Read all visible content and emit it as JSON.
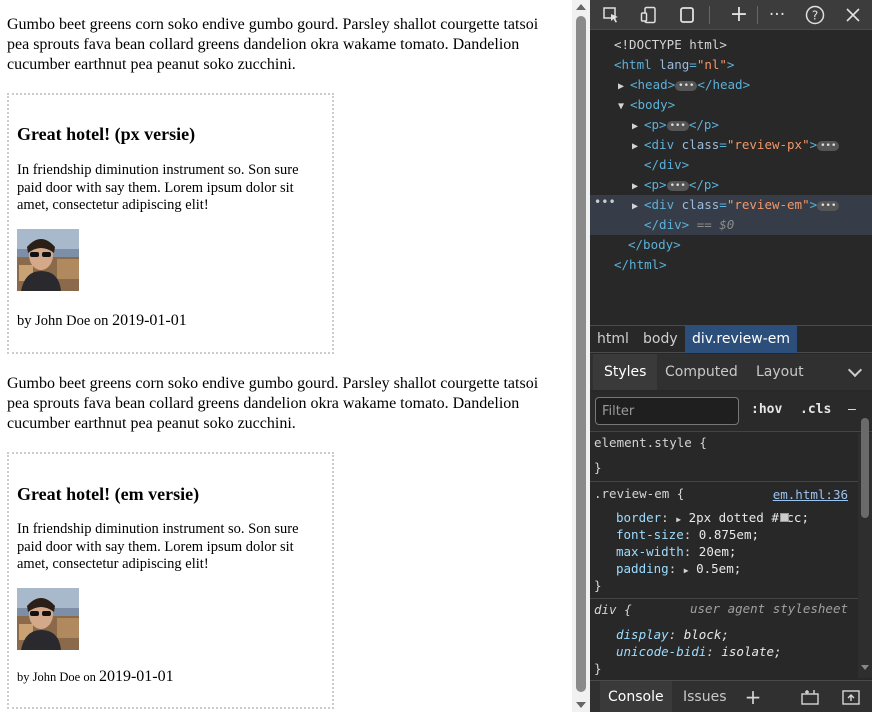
{
  "page": {
    "paragraph": "Gumbo beet greens corn soko endive gumbo gourd. Parsley shallot courgette tatsoi pea sprouts fava bean collard greens dandelion okra wakame tomato. Dandelion cucumber earthnut pea peanut soko zucchini.",
    "review_px": {
      "title": "Great hotel! (px versie)",
      "text": "In friendship diminution instrument so. Son sure paid door with say them. Lorem ipsum dolor sit amet, consectetur adipiscing elit!",
      "byline": "by John Doe on ",
      "date": "2019-01-01"
    },
    "review_em": {
      "title": "Great hotel! (em versie)",
      "text": "In friendship diminution instrument so. Son sure paid door with say them. Lorem ipsum dolor sit amet, consectetur adipiscing elit!",
      "byline": "by John Doe on ",
      "date": "2019-01-01"
    }
  },
  "devtools": {
    "toolbar_icons": [
      "inspect-icon",
      "device-icon",
      "panel-icon",
      "new-tab-icon",
      "more-icon",
      "help-icon",
      "close-icon"
    ],
    "dom": {
      "doctype": "<!DOCTYPE html>",
      "html_tag": "<html",
      "html_attr_name": "lang",
      "html_attr_value": "\"nl\"",
      "head": "<head>",
      "head_close": "</head>",
      "body": "<body>",
      "p_open": "<p>",
      "p_close": "</p>",
      "div_tag": "<div",
      "class_attr": "class",
      "div_px_class": "\"review-px\"",
      "div_em_class": "\"review-em\"",
      "div_close": "</div>",
      "dollar_zero": "== $0",
      "body_close": "</body>",
      "html_close": "</html>",
      "gutter": "•••"
    },
    "breadcrumbs": [
      "html",
      "body",
      "div.review-em"
    ],
    "tabs": [
      "Styles",
      "Computed",
      "Layout"
    ],
    "filter_placeholder": "Filter",
    "filter_buttons": [
      ":hov",
      ".cls"
    ],
    "styles": {
      "element_style": "element.style {",
      "close_brace": "}",
      "review_selector": ".review-em {",
      "review_source": "em.html:36",
      "props": [
        {
          "name": "border",
          "value": "2px dotted #ccc;"
        },
        {
          "name": "font-size",
          "value": "0.875em;"
        },
        {
          "name": "max-width",
          "value": "20em;"
        },
        {
          "name": "padding",
          "value": "0.5em;"
        }
      ],
      "ua_selector": "div {",
      "ua_source": "user agent stylesheet",
      "ua_props": [
        {
          "name": "display",
          "value": "block;"
        },
        {
          "name": "unicode-bidi",
          "value": "isolate;"
        }
      ]
    },
    "drawer_tabs": [
      "Console",
      "Issues"
    ]
  }
}
